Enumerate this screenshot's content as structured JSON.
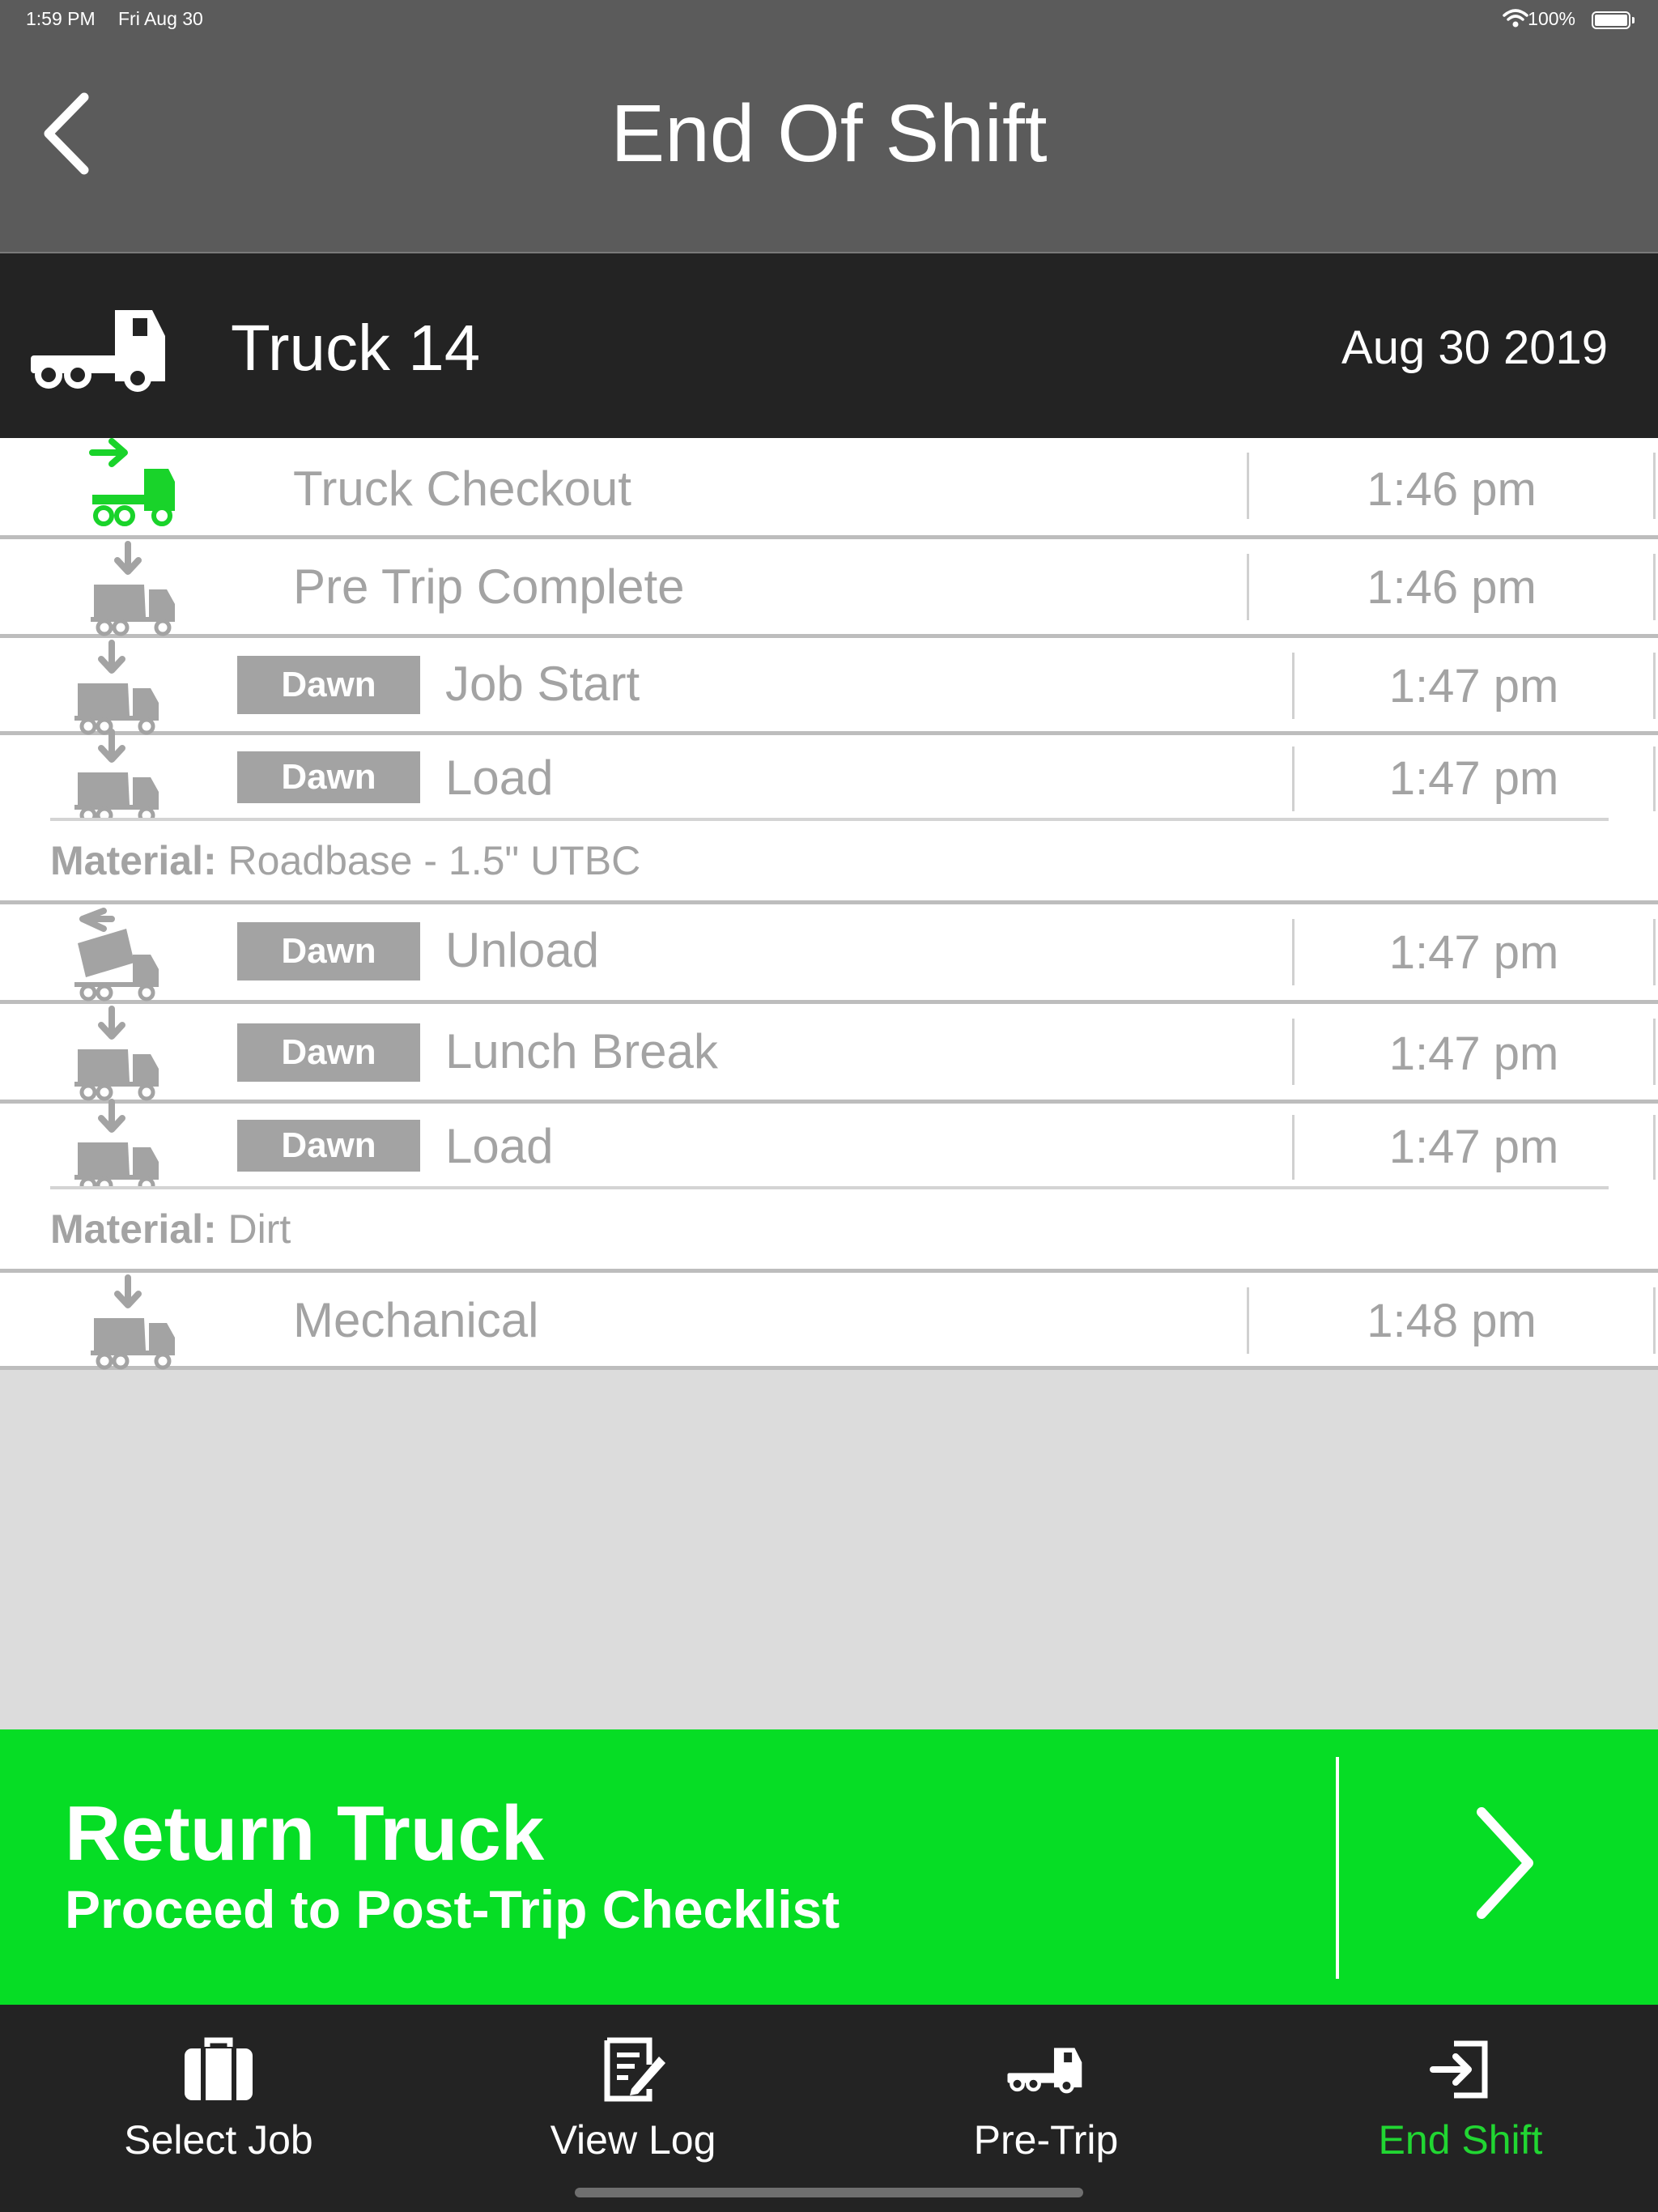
{
  "status_bar": {
    "time": "1:59 PM",
    "date": "Fri Aug 30",
    "battery": "100%"
  },
  "header": {
    "title": "End Of Shift",
    "back_icon": "chevron-left-icon"
  },
  "truck": {
    "name": "Truck 14",
    "date": "Aug 30 2019",
    "icon": "truck-icon"
  },
  "log": {
    "rows": [
      {
        "label": "Truck Checkout",
        "time": "1:46 pm",
        "icon": "truck-checkout-icon"
      },
      {
        "label": "Pre Trip Complete",
        "time": "1:46 pm",
        "icon": "dump-truck-load-icon"
      },
      {
        "badge": "Dawn",
        "label": "Job Start",
        "time": "1:47 pm",
        "icon": "dump-truck-load-icon"
      },
      {
        "badge": "Dawn",
        "label": "Load",
        "time": "1:47 pm",
        "icon": "dump-truck-load-icon",
        "material_key": "Material:",
        "material_value": "Roadbase - 1.5\" UTBC"
      },
      {
        "badge": "Dawn",
        "label": "Unload",
        "time": "1:47 pm",
        "icon": "dump-truck-unload-icon"
      },
      {
        "badge": "Dawn",
        "label": "Lunch Break",
        "time": "1:47 pm",
        "icon": "dump-truck-load-icon"
      },
      {
        "badge": "Dawn",
        "label": "Load",
        "time": "1:47 pm",
        "icon": "dump-truck-load-icon",
        "material_key": "Material:",
        "material_value": "Dirt"
      },
      {
        "label": "Mechanical",
        "time": "1:48 pm",
        "icon": "dump-truck-load-icon"
      }
    ]
  },
  "return_truck": {
    "title": "Return Truck",
    "subtitle": "Proceed to Post-Trip Checklist",
    "icon": "chevron-right-icon"
  },
  "tabs": [
    {
      "label": "Select Job",
      "icon": "briefcase-icon"
    },
    {
      "label": "View Log",
      "icon": "edit-note-icon"
    },
    {
      "label": "Pre-Trip",
      "icon": "truck-icon"
    },
    {
      "label": "End Shift",
      "icon": "sign-in-icon",
      "active": true
    }
  ],
  "colors": {
    "accent": "#06dd25",
    "active_tab": "#21d632",
    "checkout_icon": "#19d32a",
    "muted_text": "#a3a3a3",
    "header_bg": "#232323",
    "nav_bg": "#5b5b5b"
  }
}
